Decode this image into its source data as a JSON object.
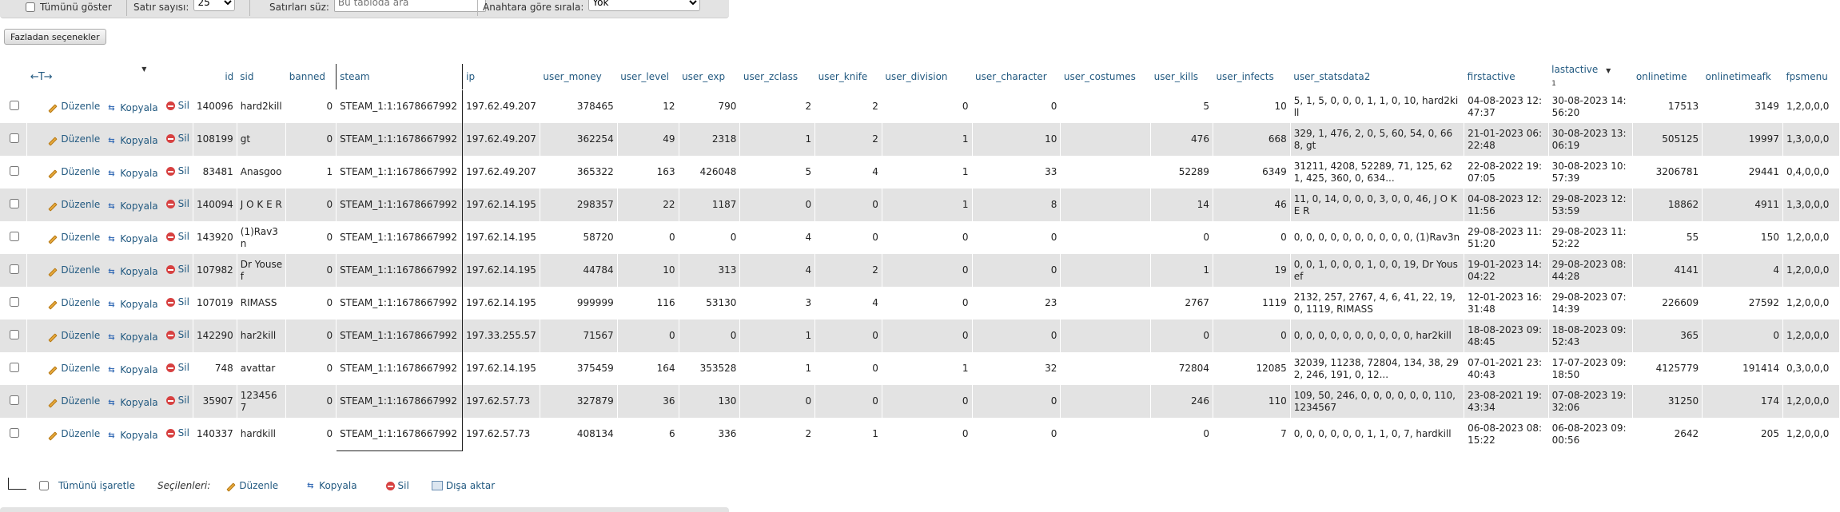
{
  "toolbar": {
    "show_all_label": "Tümünü göster",
    "rows_label": "Satır sayısı:",
    "rows_value": "25",
    "filter_label": "Satırları süz:",
    "filter_placeholder": "Bu tabloda ara",
    "sort_label": "Anahtara göre sırala:",
    "sort_value": "Yok"
  },
  "more_options_label": "Fazladan seçenekler",
  "table": {
    "nav_arrows": "←T→",
    "headers": {
      "id": "id",
      "sid": "sid",
      "banned": "banned",
      "steam": "steam",
      "ip": "ip",
      "user_money": "user_money",
      "user_level": "user_level",
      "user_exp": "user_exp",
      "user_zclass": "user_zclass",
      "user_knife": "user_knife",
      "user_division": "user_division",
      "user_character": "user_character",
      "user_costumes": "user_costumes",
      "user_kills": "user_kills",
      "user_infects": "user_infects",
      "user_statsdata2": "user_statsdata2",
      "firstactive": "firstactive",
      "lastactive": "lastactive",
      "lastactive_sort": "1",
      "onlinetime": "onlinetime",
      "onlinetimeafk": "onlinetimeafk",
      "fpsmenu": "fpsmenu"
    },
    "actions": {
      "edit": "Düzenle",
      "copy": "Kopyala",
      "delete": "Sil"
    },
    "rows": [
      {
        "id": "140096",
        "sid": "hard2kill",
        "banned": "0",
        "steam": "STEAM_1:1:1678667992",
        "ip": "197.62.49.207",
        "user_money": "378465",
        "user_level": "12",
        "user_exp": "790",
        "user_zclass": "2",
        "user_knife": "2",
        "user_division": "0",
        "user_character": "0",
        "user_costumes": "",
        "user_kills": "5",
        "user_infects": "10",
        "user_statsdata2": "5, 1, 5, 0, 0, 0, 1, 1, 0, 10, hard2kill",
        "firstactive": "04-08-2023 12:47:37",
        "lastactive": "30-08-2023 14:56:20",
        "onlinetime": "17513",
        "onlinetimeafk": "3149",
        "fpsmenu": "1,2,0,0,0"
      },
      {
        "id": "108199",
        "sid": "gt",
        "banned": "0",
        "steam": "STEAM_1:1:1678667992",
        "ip": "197.62.49.207",
        "user_money": "362254",
        "user_level": "49",
        "user_exp": "2318",
        "user_zclass": "1",
        "user_knife": "2",
        "user_division": "1",
        "user_character": "10",
        "user_costumes": "",
        "user_kills": "476",
        "user_infects": "668",
        "user_statsdata2": "329, 1, 476, 2, 0, 5, 60, 54, 0, 668, gt",
        "firstactive": "21-01-2023 06:22:48",
        "lastactive": "30-08-2023 13:06:19",
        "onlinetime": "505125",
        "onlinetimeafk": "19997",
        "fpsmenu": "1,3,0,0,0"
      },
      {
        "id": "83481",
        "sid": "Anasgoo",
        "banned": "1",
        "steam": "STEAM_1:1:1678667992",
        "ip": "197.62.49.207",
        "user_money": "365322",
        "user_level": "163",
        "user_exp": "426048",
        "user_zclass": "5",
        "user_knife": "4",
        "user_division": "1",
        "user_character": "33",
        "user_costumes": "",
        "user_kills": "52289",
        "user_infects": "6349",
        "user_statsdata2": "31211, 4208, 52289, 71, 125, 621, 425, 360, 0, 634...",
        "firstactive": "22-08-2022 19:07:05",
        "lastactive": "30-08-2023 10:57:39",
        "onlinetime": "3206781",
        "onlinetimeafk": "29441",
        "fpsmenu": "0,4,0,0,0"
      },
      {
        "id": "140094",
        "sid": "J O K E R",
        "banned": "0",
        "steam": "STEAM_1:1:1678667992",
        "ip": "197.62.14.195",
        "user_money": "298357",
        "user_level": "22",
        "user_exp": "1187",
        "user_zclass": "0",
        "user_knife": "0",
        "user_division": "1",
        "user_character": "8",
        "user_costumes": "",
        "user_kills": "14",
        "user_infects": "46",
        "user_statsdata2": "11, 0, 14, 0, 0, 0, 3, 0, 0, 46, J O K E R",
        "firstactive": "04-08-2023 12:11:56",
        "lastactive": "29-08-2023 12:53:59",
        "onlinetime": "18862",
        "onlinetimeafk": "4911",
        "fpsmenu": "1,3,0,0,0"
      },
      {
        "id": "143920",
        "sid": "(1)Rav3n",
        "banned": "0",
        "steam": "STEAM_1:1:1678667992",
        "ip": "197.62.14.195",
        "user_money": "58720",
        "user_level": "0",
        "user_exp": "0",
        "user_zclass": "4",
        "user_knife": "0",
        "user_division": "0",
        "user_character": "0",
        "user_costumes": "",
        "user_kills": "0",
        "user_infects": "0",
        "user_statsdata2": "0, 0, 0, 0, 0, 0, 0, 0, 0, 0, (1)Rav3n",
        "firstactive": "29-08-2023 11:51:20",
        "lastactive": "29-08-2023 11:52:22",
        "onlinetime": "55",
        "onlinetimeafk": "150",
        "fpsmenu": "1,2,0,0,0"
      },
      {
        "id": "107982",
        "sid": "Dr Yousef",
        "banned": "0",
        "steam": "STEAM_1:1:1678667992",
        "ip": "197.62.14.195",
        "user_money": "44784",
        "user_level": "10",
        "user_exp": "313",
        "user_zclass": "4",
        "user_knife": "2",
        "user_division": "0",
        "user_character": "0",
        "user_costumes": "",
        "user_kills": "1",
        "user_infects": "19",
        "user_statsdata2": "0, 0, 1, 0, 0, 0, 1, 0, 0, 19, Dr Yousef",
        "firstactive": "19-01-2023 14:04:22",
        "lastactive": "29-08-2023 08:44:28",
        "onlinetime": "4141",
        "onlinetimeafk": "4",
        "fpsmenu": "1,2,0,0,0"
      },
      {
        "id": "107019",
        "sid": "RIMASS",
        "banned": "0",
        "steam": "STEAM_1:1:1678667992",
        "ip": "197.62.14.195",
        "user_money": "999999",
        "user_level": "116",
        "user_exp": "53130",
        "user_zclass": "3",
        "user_knife": "4",
        "user_division": "0",
        "user_character": "23",
        "user_costumes": "",
        "user_kills": "2767",
        "user_infects": "1119",
        "user_statsdata2": "2132, 257, 2767, 4, 6, 41, 22, 19, 0, 1119, RIMASS",
        "firstactive": "12-01-2023 16:31:48",
        "lastactive": "29-08-2023 07:14:39",
        "onlinetime": "226609",
        "onlinetimeafk": "27592",
        "fpsmenu": "1,2,0,0,0"
      },
      {
        "id": "142290",
        "sid": "har2kill",
        "banned": "0",
        "steam": "STEAM_1:1:1678667992",
        "ip": "197.33.255.57",
        "user_money": "71567",
        "user_level": "0",
        "user_exp": "0",
        "user_zclass": "1",
        "user_knife": "0",
        "user_division": "0",
        "user_character": "0",
        "user_costumes": "",
        "user_kills": "0",
        "user_infects": "0",
        "user_statsdata2": "0, 0, 0, 0, 0, 0, 0, 0, 0, 0, har2kill",
        "firstactive": "18-08-2023 09:48:45",
        "lastactive": "18-08-2023 09:52:43",
        "onlinetime": "365",
        "onlinetimeafk": "0",
        "fpsmenu": "1,2,0,0,0"
      },
      {
        "id": "748",
        "sid": "avattar",
        "banned": "0",
        "steam": "STEAM_1:1:1678667992",
        "ip": "197.62.14.195",
        "user_money": "375459",
        "user_level": "164",
        "user_exp": "353528",
        "user_zclass": "1",
        "user_knife": "0",
        "user_division": "1",
        "user_character": "32",
        "user_costumes": "",
        "user_kills": "72804",
        "user_infects": "12085",
        "user_statsdata2": "32039, 11238, 72804, 134, 38, 292, 246, 191, 0, 12...",
        "firstactive": "07-01-2021 23:40:43",
        "lastactive": "17-07-2023 09:18:50",
        "onlinetime": "4125779",
        "onlinetimeafk": "191414",
        "fpsmenu": "0,3,0,0,0"
      },
      {
        "id": "35907",
        "sid": "1234567",
        "banned": "0",
        "steam": "STEAM_1:1:1678667992",
        "ip": "197.62.57.73",
        "user_money": "327879",
        "user_level": "36",
        "user_exp": "130",
        "user_zclass": "0",
        "user_knife": "0",
        "user_division": "0",
        "user_character": "0",
        "user_costumes": "",
        "user_kills": "246",
        "user_infects": "110",
        "user_statsdata2": "109, 50, 246, 0, 0, 0, 0, 0, 0, 110, 1234567",
        "firstactive": "23-08-2021 19:43:34",
        "lastactive": "07-08-2023 19:32:06",
        "onlinetime": "31250",
        "onlinetimeafk": "174",
        "fpsmenu": "1,2,0,0,0"
      },
      {
        "id": "140337",
        "sid": "hardkill",
        "banned": "0",
        "steam": "STEAM_1:1:1678667992",
        "ip": "197.62.57.73",
        "user_money": "408134",
        "user_level": "6",
        "user_exp": "336",
        "user_zclass": "2",
        "user_knife": "1",
        "user_division": "0",
        "user_character": "0",
        "user_costumes": "",
        "user_kills": "0",
        "user_infects": "7",
        "user_statsdata2": "0, 0, 0, 0, 0, 0, 1, 1, 0, 7, hardkill",
        "firstactive": "06-08-2023 08:15:22",
        "lastactive": "06-08-2023 09:00:56",
        "onlinetime": "2642",
        "onlinetimeafk": "205",
        "fpsmenu": "1,2,0,0,0"
      }
    ]
  },
  "footer": {
    "check_all_label": "Tümünü işaretle",
    "selected_label": "Seçilenleri:",
    "edit_label": "Düzenle",
    "copy_label": "Kopyala",
    "delete_label": "Sil",
    "export_label": "Dışa aktar"
  },
  "icons": [
    "pencil-icon",
    "copy-icon",
    "delete-icon",
    "export-icon",
    "sort-desc-icon"
  ],
  "colors": {
    "link": "#235a81",
    "row_alt": "#e3e3e3",
    "delete_icon": "#d74141"
  }
}
